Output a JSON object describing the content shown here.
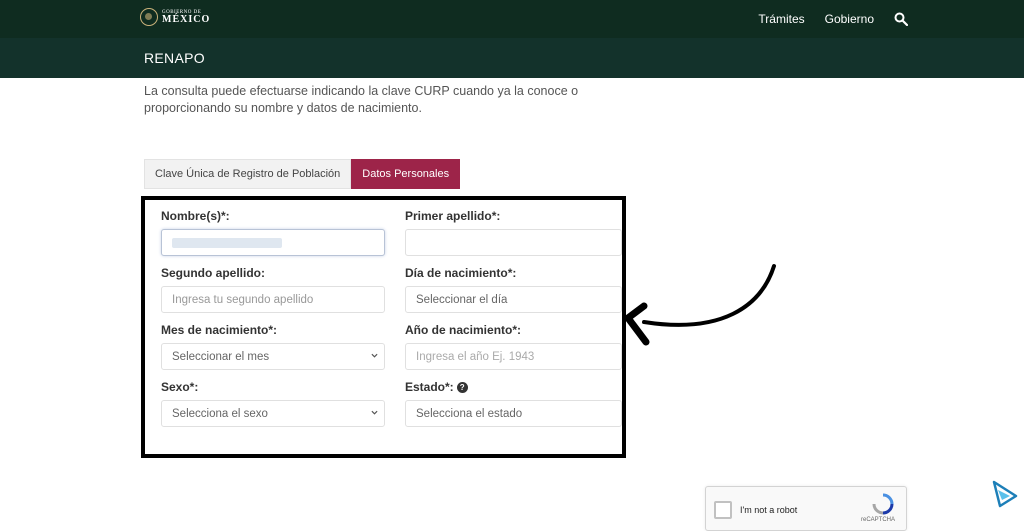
{
  "header": {
    "logo_small": "GOBIERNO DE",
    "logo_big": "MÉXICO",
    "nav": [
      "Trámites",
      "Gobierno"
    ]
  },
  "subheader": {
    "title": "RENAPO"
  },
  "intro": "La consulta puede efectuarse indicando la clave CURP cuando ya la conoce o proporcionando su nombre y datos de nacimiento.",
  "tabs": [
    {
      "label": "Clave Única de Registro de Población",
      "active": false
    },
    {
      "label": "Datos Personales",
      "active": true
    }
  ],
  "form": {
    "nombre_label": "Nombre(s)*:",
    "primer_apellido_label": "Primer apellido*:",
    "segundo_apellido_label": "Segundo apellido:",
    "segundo_apellido_placeholder": "Ingresa tu segundo apellido",
    "dia_label": "Día de nacimiento*:",
    "dia_value": "Seleccionar el día",
    "mes_label": "Mes de nacimiento*:",
    "mes_value": "Seleccionar el mes",
    "anio_label": "Año de nacimiento*:",
    "anio_placeholder": "Ingresa el año Ej. 1943",
    "sexo_label": "Sexo*:",
    "sexo_value": "Selecciona el sexo",
    "estado_label": "Estado*:",
    "estado_value": "Selecciona el estado"
  },
  "captcha": {
    "label": "I'm not a robot",
    "brand": "reCAPTCHA"
  },
  "colors": {
    "header": "#0f2c20",
    "subheader": "#13322b",
    "accent": "#9d2449"
  }
}
